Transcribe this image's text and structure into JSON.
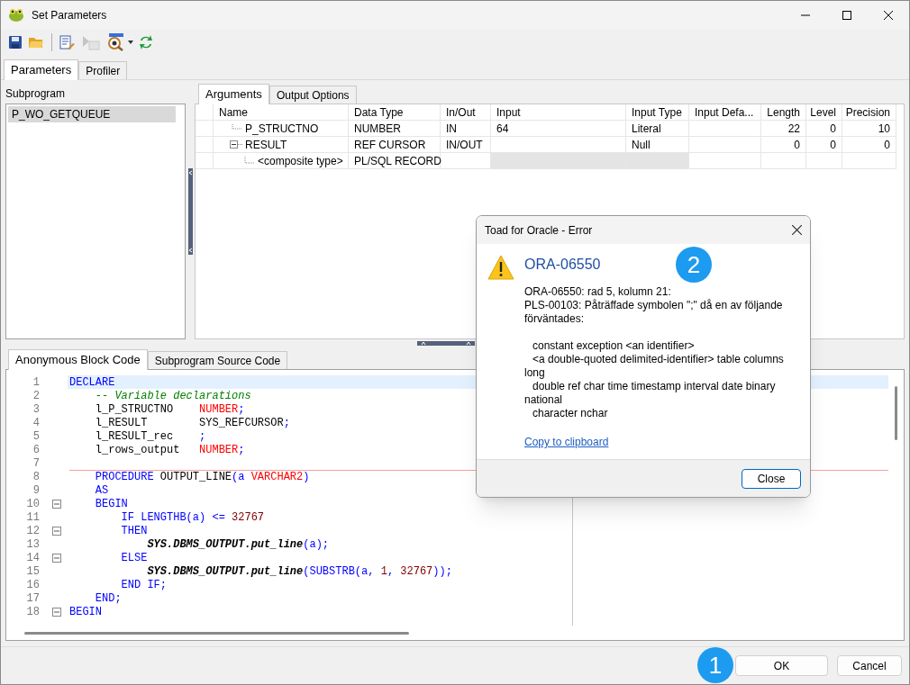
{
  "window": {
    "title": "Set Parameters"
  },
  "toolbar": [
    [
      {
        "kind": "save",
        "disabled": false,
        "dropdown": false
      },
      {
        "kind": "open",
        "disabled": false,
        "dropdown": false
      }
    ],
    [
      {
        "kind": "edit",
        "disabled": false,
        "dropdown": false
      },
      {
        "kind": "execute",
        "disabled": true,
        "dropdown": false
      },
      {
        "kind": "debug",
        "disabled": false,
        "dropdown": true
      },
      {
        "kind": "refresh",
        "disabled": false,
        "dropdown": false
      }
    ]
  ],
  "tabs": [
    {
      "label": "Parameters",
      "selected": true
    },
    {
      "label": "Profiler",
      "selected": false
    }
  ],
  "subprogram": {
    "label": "Subprogram",
    "items": [
      {
        "label": "P_WO_GETQUEUE",
        "selected": true
      }
    ]
  },
  "arguments": {
    "tabs": [
      {
        "label": "Arguments",
        "selected": true
      },
      {
        "label": "Output Options",
        "selected": false
      }
    ],
    "columns": [
      "Name",
      "Data Type",
      "In/Out",
      "Input",
      "Input Type",
      "Input Defa...",
      "Length",
      "Level",
      "Precision"
    ],
    "rows": [
      {
        "name": "P_STRUCTNO",
        "data_type": "NUMBER",
        "in_out": "IN",
        "input": "64",
        "input_type": "Literal",
        "length": "22",
        "level": "0",
        "precision": "10",
        "editable": true
      },
      {
        "name": "RESULT",
        "data_type": "REF CURSOR",
        "in_out": "IN/OUT",
        "input_type": "Null",
        "length": "0",
        "level": "0",
        "precision": "0",
        "editable": true,
        "expanded": true,
        "children": [
          {
            "name": "<composite type>",
            "data_type": "PL/SQL RECORD",
            "editable": false
          }
        ]
      }
    ]
  },
  "code": {
    "tabs": [
      {
        "label": "Anonymous Block Code",
        "selected": true
      },
      {
        "label": "Subprogram Source Code",
        "selected": false
      }
    ],
    "lines": [
      {
        "number": "1",
        "selected": true,
        "fold_marker": false,
        "divider_below": false,
        "tokens": [
          {
            "kind": "keyword",
            "text": "DECLARE"
          }
        ]
      },
      {
        "number": "2",
        "selected": false,
        "fold_marker": false,
        "divider_below": false,
        "tokens": [
          {
            "kind": "comment",
            "text": "    -- Variable declarations"
          }
        ]
      },
      {
        "number": "3",
        "selected": false,
        "fold_marker": false,
        "divider_below": false,
        "tokens": [
          {
            "kind": "plain",
            "text": "    l_P_STRUCTNO    "
          },
          {
            "kind": "type",
            "text": "NUMBER"
          },
          {
            "kind": "keyword",
            "text": ";"
          }
        ]
      },
      {
        "number": "4",
        "selected": false,
        "fold_marker": false,
        "divider_below": false,
        "tokens": [
          {
            "kind": "plain",
            "text": "    l_RESULT        SYS_REFCURSOR"
          },
          {
            "kind": "keyword",
            "text": ";"
          }
        ]
      },
      {
        "number": "5",
        "selected": false,
        "fold_marker": false,
        "divider_below": false,
        "tokens": [
          {
            "kind": "plain",
            "text": "    l_RESULT_rec    "
          },
          {
            "kind": "keyword",
            "text": ";"
          }
        ]
      },
      {
        "number": "6",
        "selected": false,
        "fold_marker": false,
        "divider_below": false,
        "tokens": [
          {
            "kind": "plain",
            "text": "    l_rows_output   "
          },
          {
            "kind": "type",
            "text": "NUMBER"
          },
          {
            "kind": "keyword",
            "text": ";"
          }
        ]
      },
      {
        "number": "7",
        "selected": false,
        "fold_marker": false,
        "divider_below": true
      },
      {
        "number": "8",
        "selected": false,
        "fold_marker": false,
        "divider_below": false,
        "tokens": [
          {
            "kind": "keyword",
            "text": "    PROCEDURE"
          },
          {
            "kind": "plain",
            "text": " OUTPUT_LINE"
          },
          {
            "kind": "keyword",
            "text": "(a "
          },
          {
            "kind": "type",
            "text": "VARCHAR2"
          },
          {
            "kind": "keyword",
            "text": ")"
          }
        ]
      },
      {
        "number": "9",
        "selected": false,
        "fold_marker": false,
        "divider_below": false,
        "tokens": [
          {
            "kind": "keyword",
            "text": "    AS"
          }
        ]
      },
      {
        "number": "10",
        "selected": false,
        "fold_marker": true,
        "divider_below": false,
        "tokens": [
          {
            "kind": "keyword",
            "text": "    BEGIN"
          }
        ]
      },
      {
        "number": "11",
        "selected": false,
        "fold_marker": false,
        "divider_below": false,
        "tokens": [
          {
            "kind": "keyword",
            "text": "        IF LENGTHB(a) <= "
          },
          {
            "kind": "number",
            "text": "32767"
          }
        ]
      },
      {
        "number": "12",
        "selected": false,
        "fold_marker": true,
        "divider_below": false,
        "tokens": [
          {
            "kind": "keyword",
            "text": "        THEN"
          }
        ]
      },
      {
        "number": "13",
        "selected": false,
        "fold_marker": false,
        "divider_below": false,
        "tokens": [
          {
            "kind": "call",
            "text": "            SYS.DBMS_OUTPUT.put_line"
          },
          {
            "kind": "keyword",
            "text": "(a);"
          }
        ]
      },
      {
        "number": "14",
        "selected": false,
        "fold_marker": true,
        "divider_below": false,
        "tokens": [
          {
            "kind": "keyword",
            "text": "        ELSE"
          }
        ]
      },
      {
        "number": "15",
        "selected": false,
        "fold_marker": false,
        "divider_below": false,
        "tokens": [
          {
            "kind": "call",
            "text": "            SYS.DBMS_OUTPUT.put_line"
          },
          {
            "kind": "keyword",
            "text": "(SUBSTRB(a, "
          },
          {
            "kind": "number",
            "text": "1"
          },
          {
            "kind": "keyword",
            "text": ", "
          },
          {
            "kind": "number",
            "text": "32767"
          },
          {
            "kind": "keyword",
            "text": "));"
          }
        ]
      },
      {
        "number": "16",
        "selected": false,
        "fold_marker": false,
        "divider_below": false,
        "tokens": [
          {
            "kind": "keyword",
            "text": "        END IF;"
          }
        ]
      },
      {
        "number": "17",
        "selected": false,
        "fold_marker": false,
        "divider_below": false,
        "tokens": [
          {
            "kind": "keyword",
            "text": "    END;"
          }
        ]
      },
      {
        "number": "18",
        "selected": false,
        "fold_marker": true,
        "divider_below": false,
        "tokens": [
          {
            "kind": "keyword",
            "text": "BEGIN"
          }
        ]
      }
    ]
  },
  "buttons": [
    {
      "label": "OK",
      "badge": "1"
    },
    {
      "label": "Cancel"
    }
  ],
  "dialog": {
    "title": "Toad for Oracle - Error",
    "heading": "ORA-06550",
    "badge": "2",
    "message": [
      "ORA-06550: rad 5, kolumn 21:",
      "PLS-00103: Påträffade symbolen \";\" då en av följande förväntades:"
    ],
    "expected": [
      "constant exception <an identifier>",
      "<a double-quoted delimited-identifier> table columns long",
      "double ref char time timestamp interval date binary national",
      "character nchar"
    ],
    "link": "Copy to clipboard",
    "button": "Close"
  }
}
